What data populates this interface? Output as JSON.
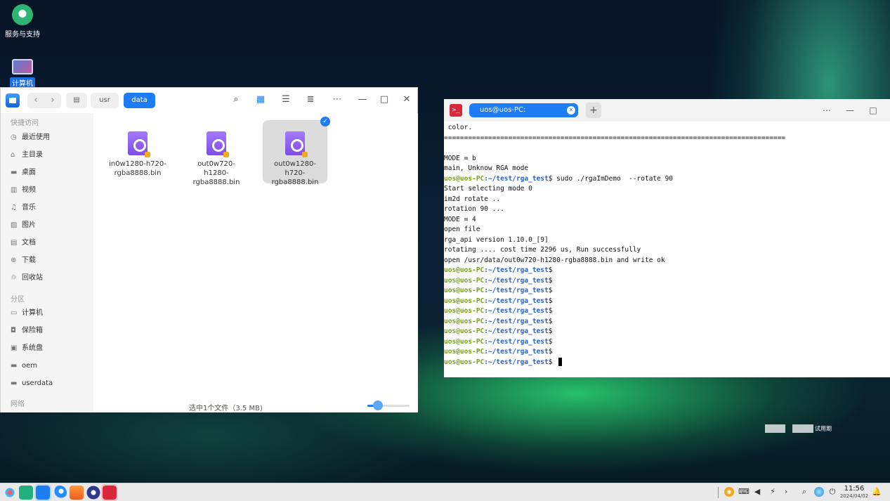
{
  "desktop": {
    "icons": [
      {
        "label": "服务与支持"
      },
      {
        "label": "计算机"
      }
    ],
    "watermark": "试用期"
  },
  "file_manager": {
    "breadcrumbs": [
      "usr",
      "data"
    ],
    "sidebar": {
      "quick_access_title": "快捷访问",
      "quick_access": [
        {
          "label": "最近使用",
          "icon": "clock-icon"
        },
        {
          "label": "主目录",
          "icon": "home-icon"
        },
        {
          "label": "桌面",
          "icon": "desktop-icon"
        },
        {
          "label": "视频",
          "icon": "video-icon"
        },
        {
          "label": "音乐",
          "icon": "music-icon"
        },
        {
          "label": "图片",
          "icon": "picture-icon"
        },
        {
          "label": "文档",
          "icon": "document-icon"
        },
        {
          "label": "下载",
          "icon": "download-icon"
        },
        {
          "label": "回收站",
          "icon": "trash-icon"
        }
      ],
      "partitions_title": "分区",
      "partitions": [
        {
          "label": "计算机",
          "icon": "computer-icon"
        },
        {
          "label": "保险箱",
          "icon": "vault-icon"
        },
        {
          "label": "系统盘",
          "icon": "disk-icon"
        },
        {
          "label": "oem",
          "icon": "disk-icon"
        },
        {
          "label": "userdata",
          "icon": "disk-icon"
        }
      ],
      "network_title": "网络"
    },
    "files": [
      {
        "name": "in0w1280-h720-rgba8888.bin",
        "selected": false
      },
      {
        "name": "out0w720-h1280-rgba8888.bin",
        "selected": false
      },
      {
        "name": "out0w1280-h720-rgba8888.bin",
        "selected": true
      }
    ],
    "status": "选中1个文件（3.5 MB)",
    "icon_size_level": 0.25
  },
  "terminal": {
    "tab_title": "uos@uos-PC: ~/test/rga_test",
    "prompt_user": "uos@uos-PC",
    "prompt_path": ":~/test/rga_test",
    "prompt_symbol": "$",
    "lines": [
      " color.",
      "=====================================================================================",
      "",
      "MODE = b",
      "main, Unknow RGA mode",
      "",
      "Start selecting mode 0",
      "im2d rotate ..",
      "rotation 90 ...",
      "MODE = 4",
      "open file",
      "rga_api version 1.10.0_[9]",
      "rotating .... cost time 2296 us, Run successfully",
      "open /usr/data/out0w720-h1280-rgba8888.bin and write ok"
    ],
    "command": " sudo ./rgaImDemo  --rotate 90",
    "empty_prompts": 10
  },
  "taskbar": {
    "time": "11:56",
    "date": "2024/04/02"
  }
}
